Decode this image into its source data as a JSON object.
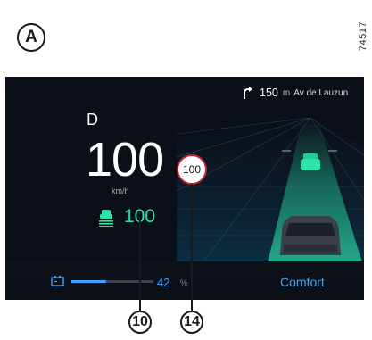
{
  "figure": {
    "letter": "A",
    "reference": "74517"
  },
  "cluster": {
    "navigation": {
      "distance": "150",
      "distance_unit": "m",
      "street": "Av de Lauzun",
      "turn_icon": "turn-right-arrow-icon"
    },
    "gear": "D",
    "speed": "100",
    "speed_unit": "km/h",
    "speed_limit": "100",
    "cruise": {
      "icon": "adaptive-cruise-control-icon",
      "set_speed": "100"
    },
    "battery": {
      "icon": "battery-icon",
      "charge_percent": "42",
      "percent_sign": "%",
      "charge_level": 0.42
    },
    "drive_mode": "Comfort"
  },
  "callouts": [
    "10",
    "14"
  ],
  "colors": {
    "screen_background": "#0b0f17",
    "cruise_green": "#2ee3a8",
    "accent_blue": "#36a6ff",
    "limit_red": "#c5242a"
  }
}
